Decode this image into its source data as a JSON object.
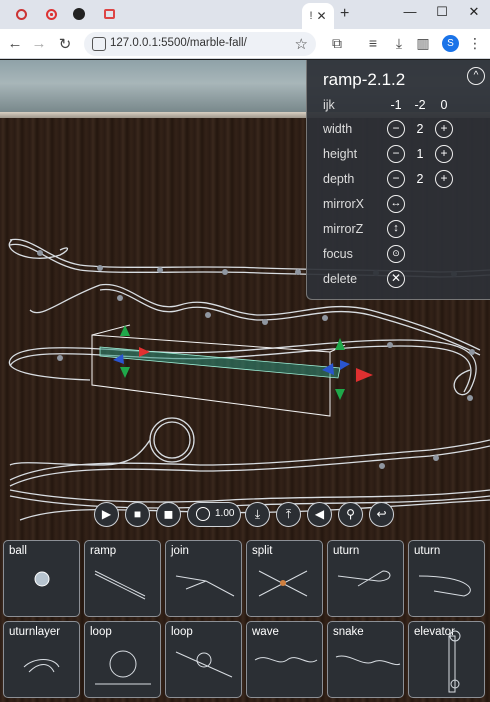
{
  "browser": {
    "tab_title": "!",
    "url": "127.0.0.1:5500/marble-fall/"
  },
  "panel": {
    "title": "ramp-2.1.2",
    "ijk": {
      "label": "ijk",
      "values": [
        "-1",
        "-2",
        "0"
      ]
    },
    "width": {
      "label": "width",
      "value": "2"
    },
    "height": {
      "label": "height",
      "value": "1"
    },
    "depth": {
      "label": "depth",
      "value": "2"
    },
    "mirrorX": {
      "label": "mirrorX"
    },
    "mirrorZ": {
      "label": "mirrorZ"
    },
    "focus": {
      "label": "focus"
    },
    "delete": {
      "label": "delete"
    }
  },
  "toolbar": {
    "speed": "1.00",
    "buttons": [
      "play",
      "stop",
      "camera",
      "speed",
      "download",
      "upload",
      "sound",
      "search",
      "undo"
    ]
  },
  "palette": [
    {
      "label": "ball"
    },
    {
      "label": "ramp"
    },
    {
      "label": "join"
    },
    {
      "label": "split"
    },
    {
      "label": "uturn"
    },
    {
      "label": "uturn"
    },
    {
      "label": "uturnlayer"
    },
    {
      "label": "loop"
    },
    {
      "label": "loop"
    },
    {
      "label": "wave"
    },
    {
      "label": "snake"
    },
    {
      "label": "elevator"
    }
  ],
  "colors": {
    "panel_bg": "#2d3037",
    "wood": "#2b1c14",
    "selection": "#2e8f7a",
    "gizmo_red": "#e03030",
    "gizmo_green": "#1fa84a",
    "gizmo_blue": "#2a55d0"
  }
}
